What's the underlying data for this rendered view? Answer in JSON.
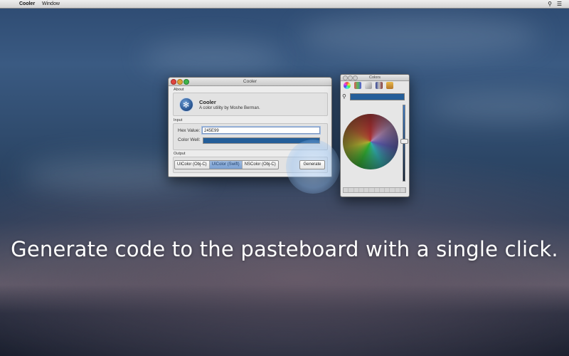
{
  "menubar": {
    "app_name": "Cooler",
    "menu_window": "Window"
  },
  "cooler_window": {
    "title": "Cooler",
    "about_label": "About",
    "app_name": "Cooler",
    "app_description": "A color utility by Moshe Berman.",
    "input_label": "Input",
    "hex_label": "Hex Value:",
    "hex_value": "245E99",
    "color_well_label": "Color Well:",
    "color_well_color": "#245e99",
    "output_label": "Output",
    "output_options": [
      "UIColor (Obj-C)",
      "UIColor (Swift)",
      "NSColor (Obj-C)"
    ],
    "selected_output": "UIColor (Swift)",
    "generate_label": "Generate"
  },
  "colors_panel": {
    "title": "Colors",
    "current_color": "#245e99"
  },
  "caption": "Generate code to the pasteboard with a single click."
}
